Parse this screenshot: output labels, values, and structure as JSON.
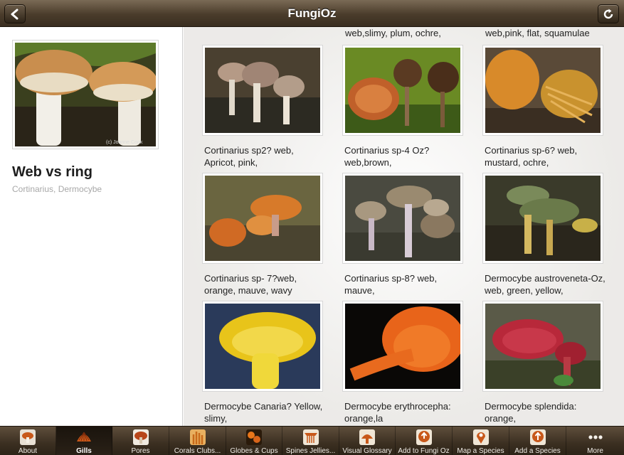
{
  "app": {
    "title": "FungiOz"
  },
  "nav": {
    "back_icon": "back-arrow-icon",
    "refresh_icon": "refresh-icon"
  },
  "detail": {
    "title": "Web vs ring",
    "subtitle": "Cortinarius, Dermocybe",
    "photo_credit": "(c) Joanne Cook"
  },
  "grid": {
    "partial_captions": [
      "web,slimy, plum, ochre,",
      "",
      "web,pink, flat, squamulae"
    ],
    "items": [
      {
        "caption": "Cortinarius sp2? web, Apricot, pink,"
      },
      {
        "caption": "Cortinarius sp-4 Oz? web,brown,"
      },
      {
        "caption": "Cortinarius sp-6? web, mustard, ochre,"
      },
      {
        "caption": "Cortinarius sp- 7?web, orange, mauve, wavy"
      },
      {
        "caption": "Cortinarius sp-8? web, mauve,"
      },
      {
        "caption": "Dermocybe austroveneta-Oz, web, green, yellow,"
      },
      {
        "caption": "Dermocybe Canaria? Yellow, slimy,"
      },
      {
        "caption": "Dermocybe erythrocepha: orange,la"
      },
      {
        "caption": "Dermocybe splendida: orange,"
      }
    ]
  },
  "tabs": [
    {
      "label": "About",
      "icon": "about-mushroom-icon"
    },
    {
      "label": "Gills",
      "icon": "gills-icon"
    },
    {
      "label": "Pores",
      "icon": "pores-icon"
    },
    {
      "label": "Corals Clubs...",
      "icon": "corals-icon"
    },
    {
      "label": "Globes & Cups",
      "icon": "globes-icon"
    },
    {
      "label": "Spines Jellies...",
      "icon": "spines-icon"
    },
    {
      "label": "Visual Glossary",
      "icon": "glossary-icon"
    },
    {
      "label": "Add to Fungi Oz",
      "icon": "add-to-icon"
    },
    {
      "label": "Map a Species",
      "icon": "map-pin-icon"
    },
    {
      "label": "Add a Species",
      "icon": "add-species-icon"
    },
    {
      "label": "More",
      "icon": "more-dots-icon"
    }
  ],
  "colors": {
    "bar_brown": "#4a3c2b",
    "accent_orange": "#d2691e"
  }
}
